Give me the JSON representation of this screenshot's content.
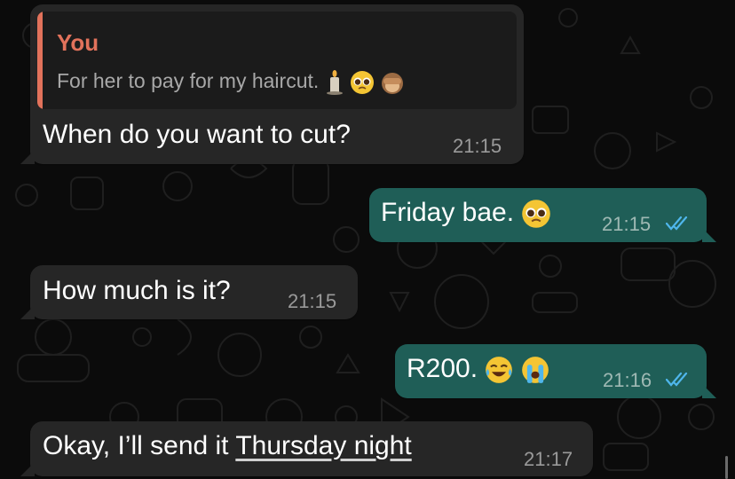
{
  "colors": {
    "background": "#0b0b0b",
    "incoming_bubble": "#262626",
    "outgoing_bubble": "#1f5e57",
    "read_ticks": "#4fb6ec",
    "quote_accent": "#e2725b"
  },
  "messages": [
    {
      "direction": "incoming",
      "quote": {
        "author": "You",
        "text": "For her to pay for my haircut."
      },
      "text": "When do you want to cut?",
      "time": "21:15"
    },
    {
      "direction": "outgoing",
      "text": "Friday bae.",
      "time": "21:15",
      "status": "read"
    },
    {
      "direction": "incoming",
      "text": "How much is it?",
      "time": "21:15"
    },
    {
      "direction": "outgoing",
      "text": "R200.",
      "time": "21:16",
      "status": "read"
    },
    {
      "direction": "incoming",
      "text_prefix": "Okay, I’ll send it ",
      "text_link": "Thursday night",
      "time": "21:17"
    }
  ]
}
